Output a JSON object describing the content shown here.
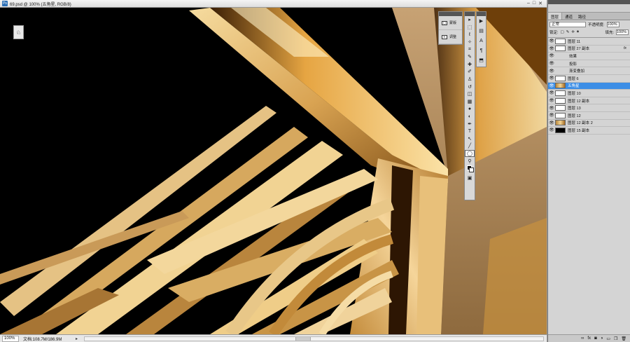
{
  "document": {
    "title": "69.psd @ 100% (五角星, RGB/8)",
    "app_icon": "Ps",
    "window_buttons": [
      "–",
      "□",
      "✕"
    ],
    "zoom": "100%",
    "doc_size": "文档:108.7M/186.9M"
  },
  "mini_tool_icon": "♘",
  "adjustments_panel": {
    "items": [
      {
        "label": "蒙版",
        "icon": "mask-icon"
      },
      {
        "label": "调整",
        "icon": "adjust-icon"
      }
    ]
  },
  "tools": [
    {
      "glyph": "▸",
      "name": "move-tool"
    },
    {
      "glyph": "⬚",
      "name": "marquee-tool"
    },
    {
      "glyph": "ℓ",
      "name": "lasso-tool"
    },
    {
      "glyph": "✧",
      "name": "quick-select-tool"
    },
    {
      "glyph": "⌗",
      "name": "crop-tool"
    },
    {
      "glyph": "✎",
      "name": "eyedropper-tool"
    },
    {
      "glyph": "✚",
      "name": "healing-tool"
    },
    {
      "glyph": "✐",
      "name": "brush-tool"
    },
    {
      "glyph": "♙",
      "name": "stamp-tool"
    },
    {
      "glyph": "↺",
      "name": "history-brush-tool"
    },
    {
      "glyph": "◫",
      "name": "eraser-tool"
    },
    {
      "glyph": "▦",
      "name": "gradient-tool"
    },
    {
      "glyph": "●",
      "name": "blur-tool"
    },
    {
      "glyph": "◐",
      "name": "dodge-tool"
    },
    {
      "glyph": "✒",
      "name": "pen-tool"
    },
    {
      "glyph": "T",
      "name": "type-tool"
    },
    {
      "glyph": "↖",
      "name": "path-select-tool"
    },
    {
      "glyph": "╱",
      "name": "shape-tool"
    },
    {
      "glyph": "◯",
      "name": "ellipse-tool",
      "active": true
    },
    {
      "glyph": "⚲",
      "name": "zoom-tool"
    }
  ],
  "strip_icons": [
    {
      "glyph": "▶",
      "name": "actions-icon"
    },
    {
      "glyph": "▤",
      "name": "histogram-icon"
    },
    {
      "glyph": "A",
      "name": "character-icon"
    },
    {
      "glyph": "¶",
      "name": "paragraph-icon"
    },
    {
      "glyph": "⬒",
      "name": "info-icon"
    }
  ],
  "layers_panel": {
    "tabs": [
      "图层",
      "通道",
      "路径"
    ],
    "blend_mode": "正常",
    "opacity_label": "不透明度:",
    "opacity": "100%",
    "lock_label": "锁定:",
    "fill_label": "填充:",
    "fill": "100%",
    "layers": [
      {
        "name": "图层 11",
        "thumb": "white",
        "visible": true
      },
      {
        "name": "图层 27 副本",
        "thumb": "white",
        "visible": true,
        "fx": "fx"
      },
      {
        "name": "效果",
        "sub": true,
        "visible": true
      },
      {
        "name": "投影",
        "sub": true,
        "visible": true
      },
      {
        "name": "渐变叠加",
        "sub": true,
        "visible": true
      },
      {
        "name": "图层 6",
        "thumb": "white",
        "visible": true
      },
      {
        "name": "五角星",
        "thumb": "gold",
        "visible": true,
        "selected": true
      },
      {
        "name": "图层 10",
        "thumb": "white",
        "visible": true
      },
      {
        "name": "图层 12 副本",
        "thumb": "white",
        "visible": true
      },
      {
        "name": "图层 13",
        "thumb": "white",
        "visible": true
      },
      {
        "name": "图层 12",
        "thumb": "white",
        "visible": true
      },
      {
        "name": "图层 12 副本 2",
        "thumb": "gold",
        "visible": true
      },
      {
        "name": "图层 15 副本",
        "thumb": "black",
        "visible": true
      }
    ],
    "footer_icons": [
      "link-icon",
      "fx-icon",
      "mask-icon",
      "adjustment-icon",
      "folder-icon",
      "new-layer-icon",
      "trash-icon"
    ]
  },
  "colors": {
    "selection": "#3c8ee6",
    "gold_light": "#f3d494",
    "gold_dark": "#a36a22"
  }
}
